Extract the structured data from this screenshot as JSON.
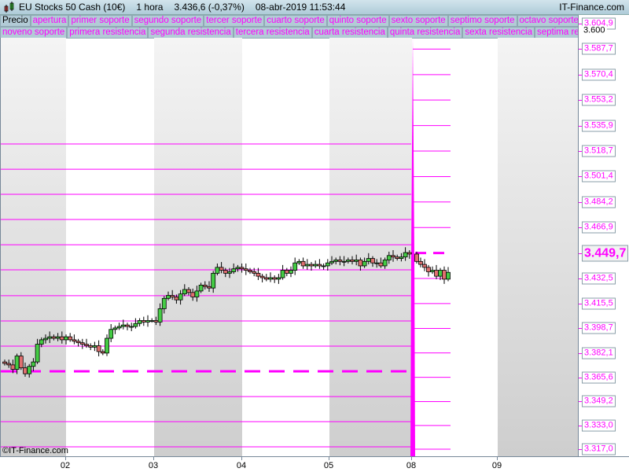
{
  "title": {
    "instrument": "EU Stocks 50 Cash (10€)",
    "timeframe": "1 hora",
    "price": "3.436,6 (-0,37%)",
    "datetime": "08-abr-2019 11:53:44",
    "brand": "IT-Finance.com"
  },
  "legend_row1": [
    "Precio",
    "apertura",
    "primer soporte",
    "segundo soporte",
    "tercer soporte",
    "cuarto soporte",
    "quinto soporte",
    "sexto soporte",
    "septimo soporte",
    "octavo soporte"
  ],
  "legend_row2": [
    "noveno soporte",
    "primera resistencia",
    "segunda resistencia",
    "tercera resistencia",
    "cuarta resistencia",
    "quinta resistencia",
    "sexta resistencia",
    "septima resistenci"
  ],
  "copyright": "©IT-Finance.com",
  "colors": {
    "level": "#ff00ff",
    "up": "#44cc44",
    "down": "#e07070",
    "band": "#d0d0d0"
  },
  "chart_data": {
    "type": "candlestick",
    "ylim": [
      3317.0,
      3604.9
    ],
    "y_labels": [
      {
        "v": 3604.9,
        "t": "3.604,9"
      },
      {
        "v": 3600,
        "t": "3.600",
        "plain": true
      },
      {
        "v": 3587.7,
        "t": "3.587,7"
      },
      {
        "v": 3570.4,
        "t": "3.570,4"
      },
      {
        "v": 3553.2,
        "t": "3.553,2"
      },
      {
        "v": 3535.9,
        "t": "3.535,9"
      },
      {
        "v": 3518.7,
        "t": "3.518,7"
      },
      {
        "v": 3501.4,
        "t": "3.501,4"
      },
      {
        "v": 3484.2,
        "t": "3.484,2"
      },
      {
        "v": 3466.9,
        "t": "3.466,9"
      },
      {
        "v": 3449.7,
        "t": "3.449,7",
        "big": true
      },
      {
        "v": 3432.5,
        "t": "3.432,5"
      },
      {
        "v": 3415.5,
        "t": "3.415,5"
      },
      {
        "v": 3398.7,
        "t": "3.398,7"
      },
      {
        "v": 3382.1,
        "t": "3.382,1"
      },
      {
        "v": 3365.6,
        "t": "3.365,6"
      },
      {
        "v": 3349.2,
        "t": "3.349,2"
      },
      {
        "v": 3333.0,
        "t": "3.333,0"
      },
      {
        "v": 3317.0,
        "t": "3.317,0"
      }
    ],
    "x_labels": [
      "02",
      "03",
      "04",
      "05",
      "08",
      "09"
    ],
    "prev_levels": [
      3523.5,
      3506.4,
      3489.4,
      3472.4,
      3455.3,
      3438.3,
      3420.8,
      3403.7,
      3386.7,
      3352.6,
      3335.6,
      3318.6
    ],
    "prev_open_level": 3369.7,
    "current_open_level": 3449.7,
    "closes_prev_days": [
      3375,
      3374,
      3371,
      3380,
      3372,
      3368,
      3373,
      3376,
      3388,
      3391,
      3392,
      3393,
      3392,
      3393,
      3391,
      3393,
      3391,
      3390,
      3389,
      3388,
      3387,
      3386,
      3387,
      3383,
      3382,
      3392,
      3398,
      3399,
      3400,
      3401,
      3400,
      3400,
      3402,
      3404,
      3403,
      3404,
      3404,
      3403,
      3412,
      3419,
      3421,
      3420,
      3418,
      3422,
      3425,
      3423,
      3420,
      3424,
      3428,
      3427,
      3426,
      3436,
      3440,
      3438,
      3436,
      3437,
      3439,
      3440,
      3439,
      3438,
      3437,
      3436,
      3434,
      3433,
      3432,
      3433,
      3432,
      3433,
      3438,
      3436,
      3438,
      3443,
      3444,
      3441,
      3442,
      3441,
      3442,
      3441,
      3441,
      3443,
      3444,
      3445,
      3444,
      3444,
      3445,
      3444,
      3445,
      3441,
      3444,
      3446,
      3443,
      3443,
      3441,
      3445,
      3448,
      3447,
      3446,
      3447,
      3450,
      3449
    ],
    "closes_today": [
      3444,
      3442,
      3440,
      3437,
      3438,
      3434,
      3438,
      3432,
      3436.6
    ]
  }
}
